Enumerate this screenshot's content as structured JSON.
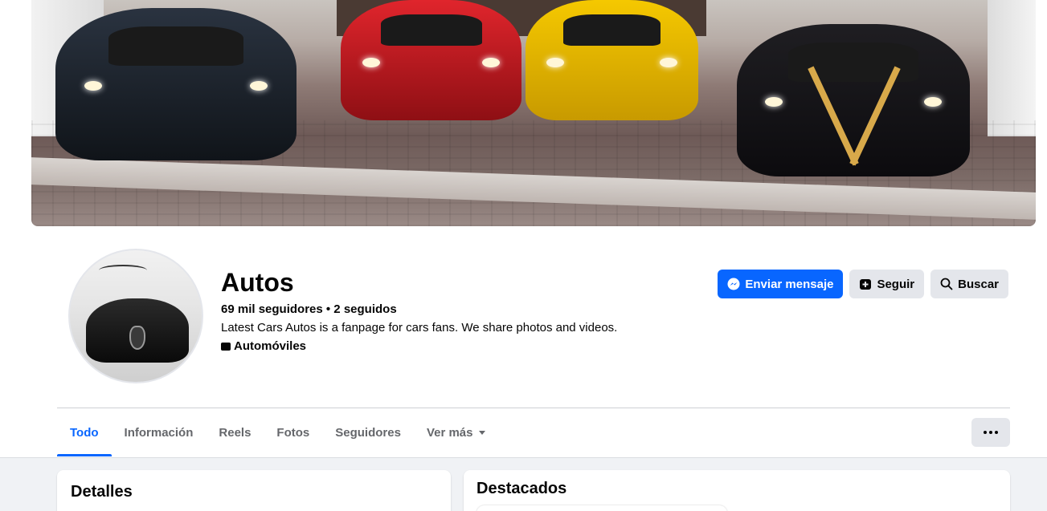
{
  "page": {
    "name": "Autos",
    "followers_text": "69 mil seguidores • 2 seguidos",
    "bio": "Latest Cars Autos is a fanpage for cars fans. We share photos and videos.",
    "category": "Automóviles"
  },
  "actions": {
    "message_label": "Enviar mensaje",
    "follow_label": "Seguir",
    "search_label": "Buscar"
  },
  "tabs": [
    {
      "label": "Todo",
      "active": true
    },
    {
      "label": "Información"
    },
    {
      "label": "Reels"
    },
    {
      "label": "Fotos"
    },
    {
      "label": "Seguidores"
    },
    {
      "label": "Ver más"
    }
  ],
  "sections": {
    "details_title": "Detalles",
    "featured_title": "Destacados"
  },
  "colors": {
    "accent": "#0866ff",
    "secondary_button": "#e4e6eb",
    "feed_background": "#f0f2f5",
    "muted_text": "#65676b"
  }
}
